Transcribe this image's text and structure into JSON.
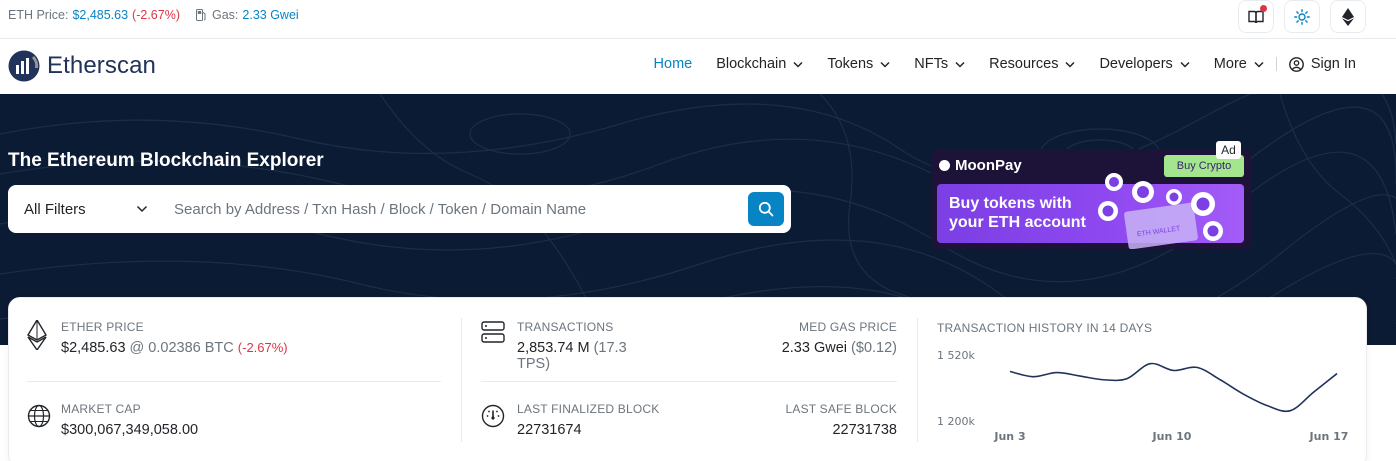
{
  "topbar": {
    "eth_price_label": "ETH Price:",
    "eth_price_value": "$2,485.63",
    "eth_price_change": "(-2.67%)",
    "gas_label": "Gas:",
    "gas_value": "2.33 Gwei",
    "icons": [
      "book-icon",
      "sun-icon",
      "ethereum-icon"
    ]
  },
  "header": {
    "logo_text": "Etherscan",
    "nav": {
      "home": "Home",
      "blockchain": "Blockchain",
      "tokens": "Tokens",
      "nfts": "NFTs",
      "resources": "Resources",
      "developers": "Developers",
      "more": "More",
      "sign_in": "Sign In"
    }
  },
  "hero": {
    "title": "The Ethereum Blockchain Explorer",
    "filter_selected": "All Filters",
    "search_placeholder": "Search by Address / Txn Hash / Block / Token / Domain Name"
  },
  "ad": {
    "label": "Ad",
    "brand": "MoonPay",
    "cta": "Buy Crypto",
    "headline_1": "Buy tokens with",
    "headline_2": "your ETH account",
    "wallet_text": "ETH WALLET"
  },
  "stats": {
    "ether_price": {
      "label": "ETHER PRICE",
      "usd": "$2,485.63",
      "btc": "@ 0.02386 BTC",
      "change": "(-2.67%)"
    },
    "market_cap": {
      "label": "MARKET CAP",
      "value": "$300,067,349,058.00"
    },
    "transactions": {
      "label": "TRANSACTIONS",
      "value": "2,853.74 M",
      "tps": "(17.3 TPS)"
    },
    "med_gas_price": {
      "label": "MED GAS PRICE",
      "value": "2.33 Gwei",
      "usd": "($0.12)"
    },
    "last_finalized_block": {
      "label": "LAST FINALIZED BLOCK",
      "value": "22731674"
    },
    "last_safe_block": {
      "label": "LAST SAFE BLOCK",
      "value": "22731738"
    }
  },
  "chart_data": {
    "type": "line",
    "title": "TRANSACTION HISTORY IN 14 DAYS",
    "ytick_labels": [
      "1 520k",
      "1 200k"
    ],
    "xtick_labels": [
      "Jun 3",
      "Jun 10",
      "Jun 17"
    ],
    "x": [
      "Jun 3",
      "Jun 4",
      "Jun 5",
      "Jun 6",
      "Jun 7",
      "Jun 8",
      "Jun 9",
      "Jun 10",
      "Jun 11",
      "Jun 12",
      "Jun 13",
      "Jun 14",
      "Jun 15",
      "Jun 16",
      "Jun 17"
    ],
    "values": [
      1440,
      1415,
      1435,
      1418,
      1400,
      1405,
      1478,
      1445,
      1460,
      1400,
      1330,
      1275,
      1250,
      1340,
      1430
    ],
    "ylim": [
      1200,
      1520
    ],
    "color": "#21325b",
    "grid": false
  },
  "colors": {
    "accent": "#0784c3",
    "negative": "#dc3545",
    "hero_bg": "#0b1b33",
    "brand_dark": "#21325b"
  }
}
